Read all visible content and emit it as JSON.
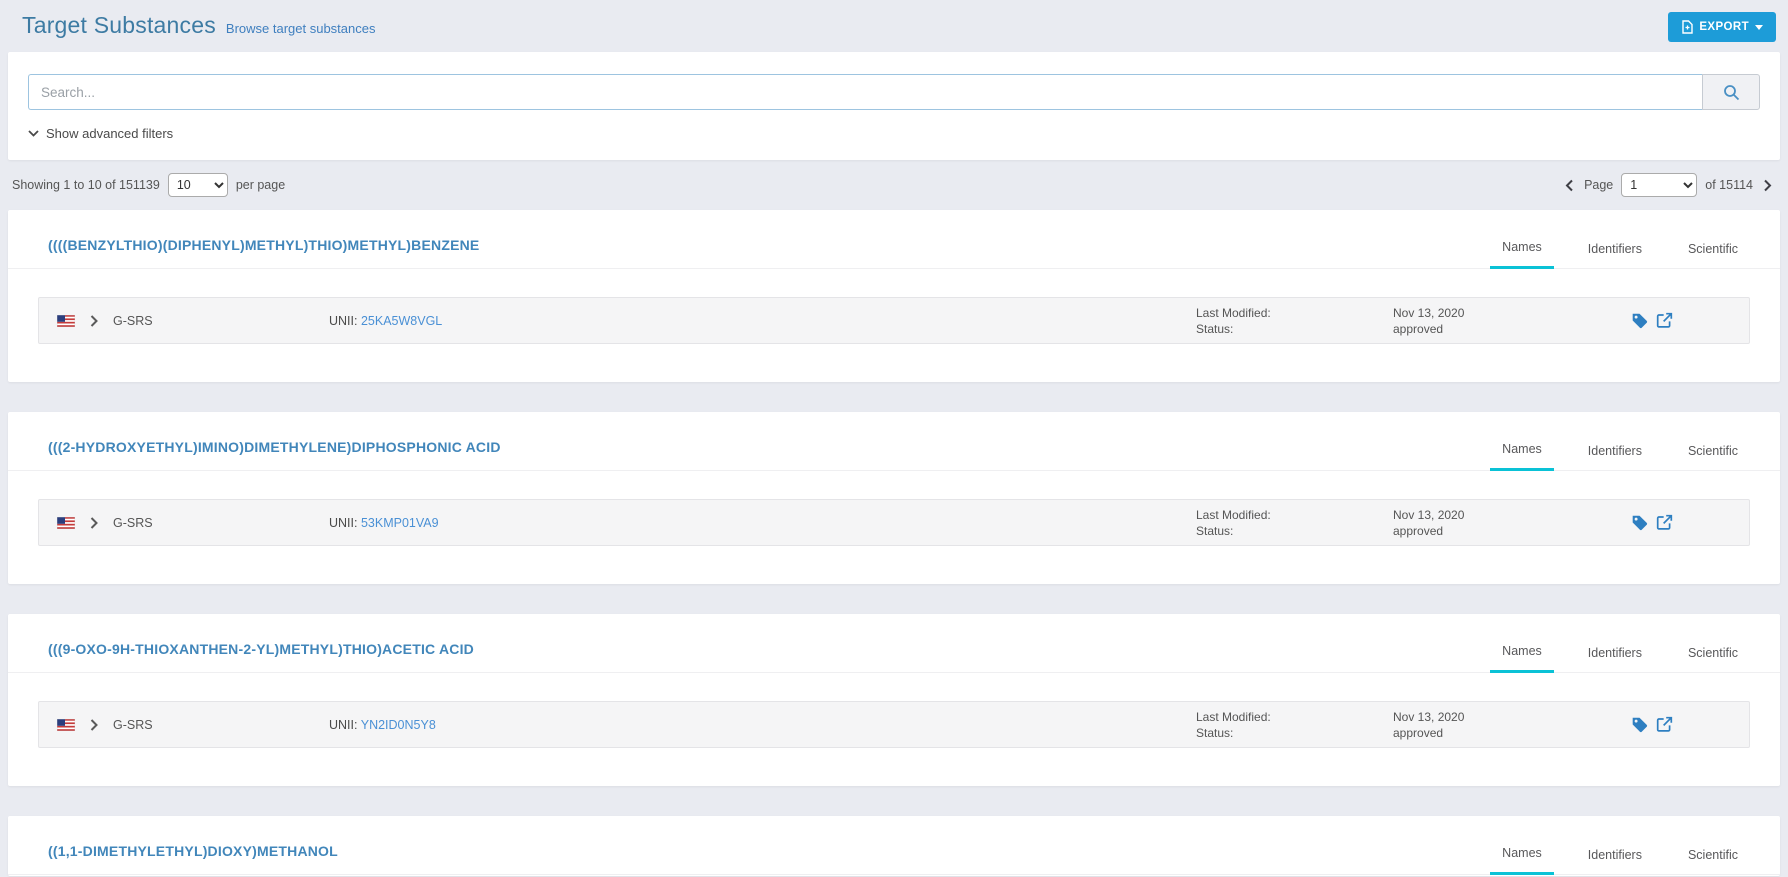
{
  "header": {
    "title": "Target Substances",
    "subtitle": "Browse target substances",
    "export_label": "EXPORT"
  },
  "search": {
    "placeholder": "Search...",
    "advanced_filters_label": "Show advanced filters"
  },
  "list_meta": {
    "showing_text": "Showing 1 to 10 of 151139",
    "per_page_value": "10",
    "per_page_suffix": "per page",
    "page_label": "Page",
    "page_value": "1",
    "page_total_text": "of 15114"
  },
  "tabs": [
    "Names",
    "Identifiers",
    "Scientific"
  ],
  "row_labels": {
    "unii": "UNII:",
    "last_modified": "Last Modified:",
    "status": "Status:"
  },
  "substances": [
    {
      "name": "((((BENZYLTHIO)(DIPHENYL)METHYL)THIO)METHYL)BENZENE",
      "source": "G-SRS",
      "unii": "25KA5W8VGL",
      "last_modified": "Nov 13, 2020",
      "status": "approved"
    },
    {
      "name": "(((2-HYDROXYETHYL)IMINO)DIMETHYLENE)DIPHOSPHONIC ACID",
      "source": "G-SRS",
      "unii": "53KMP01VA9",
      "last_modified": "Nov 13, 2020",
      "status": "approved"
    },
    {
      "name": "(((9-OXO-9H-THIOXANTHEN-2-YL)METHYL)THIO)ACETIC ACID",
      "source": "G-SRS",
      "unii": "YN2ID0N5Y8",
      "last_modified": "Nov 13, 2020",
      "status": "approved"
    },
    {
      "name": "((1,1-DIMETHYLETHYL)DIOXY)METHANOL"
    }
  ],
  "colors": {
    "accent_blue": "#1d9cd8",
    "link_blue": "#4a90d5",
    "name_blue": "#4186ba",
    "tab_active_underline": "#0ac2d6",
    "page_background": "#e9ebf1"
  },
  "icons": {
    "export": "file-export",
    "search": "magnifier",
    "advanced_filters": "chevron-down",
    "row_flag": "us-flag",
    "row_expand": "chevron-right",
    "row_tag": "tag",
    "row_open": "external-link",
    "prev_page": "chevron-left",
    "next_page": "chevron-right"
  }
}
